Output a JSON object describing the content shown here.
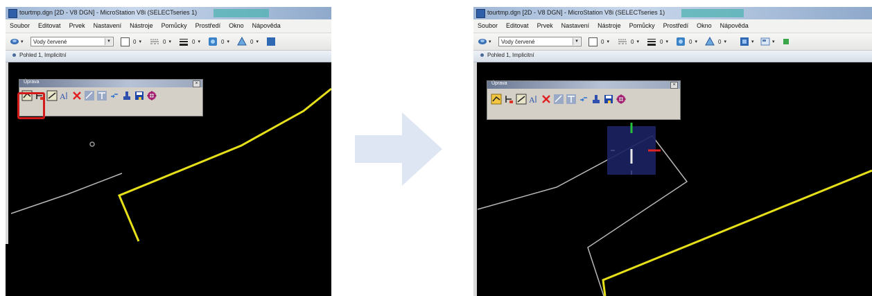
{
  "left": {
    "window_title": "tourtmp.dgn [2D - V8 DGN] - MicroStation V8i (SELECTseries 1)",
    "menu": [
      "Soubor",
      "Editovat",
      "Prvek",
      "Nastavení",
      "Nástroje",
      "Pomůcky",
      "Prostředí",
      "Okno",
      "Nápověda"
    ],
    "level": "Vody červené",
    "color_value": "0",
    "style_value": "0",
    "weight_value": "0",
    "transp_value": "0",
    "prio_value": "0",
    "view_title": "Pohled 1, Implicitní",
    "palette_title": "Úprava"
  },
  "right": {
    "window_title": "tourtmp.dgn [2D - V8 DGN] - MicroStation V8i (SELECTseries 1)",
    "menu": [
      "Soubor",
      "Editovat",
      "Prvek",
      "Nastavení",
      "Nástroje",
      "Pomůcky",
      "Prostředí",
      "Okno",
      "Nápověda"
    ],
    "level": "Vody červené",
    "color_value": "0",
    "style_value": "0",
    "weight_value": "0",
    "transp_value": "0",
    "prio_value": "0",
    "view_title": "Pohled 1, Implicitní",
    "palette_title": "Úprava"
  },
  "icons": {
    "arrow": "right-arrow-icon",
    "palette_tools": [
      "modify-element-icon",
      "partial-delete-icon",
      "extend-line-icon",
      "modify-text-icon",
      "delete-element-icon",
      "trim-icon",
      "intellitrim-icon",
      "extend-elements-icon",
      "place-stamp-icon",
      "save-icon",
      "target-icon"
    ]
  },
  "colors": {
    "canvas": "#000000",
    "yellow_line": "#e6e01a",
    "white_line": "#b8b8b8",
    "highlight": "#d11a1a",
    "handle_box": "#1b2260"
  }
}
